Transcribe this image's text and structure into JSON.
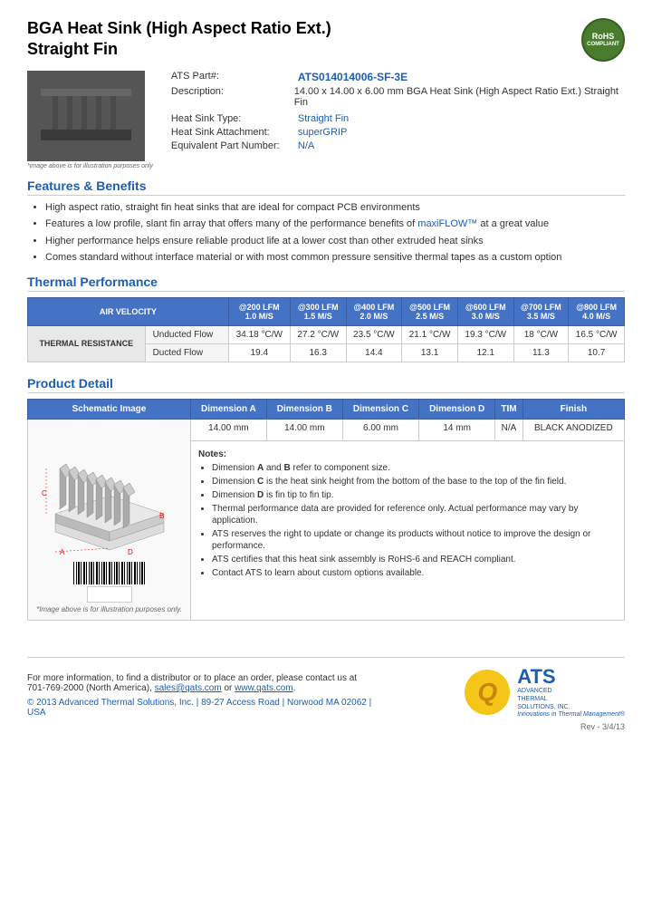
{
  "header": {
    "title_line1": "BGA Heat Sink (High Aspect Ratio Ext.)",
    "title_line2": "Straight Fin",
    "rohs": {
      "line1": "RoHS",
      "line2": "COMPLIANT"
    }
  },
  "product": {
    "part_number_label": "ATS Part#:",
    "part_number_value": "ATS014014006-SF-3E",
    "description_label": "Description:",
    "description_value": "14.00 x 14.00 x 6.00 mm  BGA Heat Sink (High Aspect Ratio Ext.) Straight Fin",
    "heat_sink_type_label": "Heat Sink Type:",
    "heat_sink_type_value": "Straight Fin",
    "attachment_label": "Heat Sink Attachment:",
    "attachment_value": "superGRIP",
    "equivalent_label": "Equivalent Part Number:",
    "equivalent_value": "N/A",
    "image_caption": "*image above is for illustration purposes only"
  },
  "features": {
    "section_title": "Features & Benefits",
    "items": [
      "High aspect ratio, straight fin heat sinks that are ideal for compact PCB environments",
      "Features a low profile, slant fin array that offers many of the performance benefits of maxiFLOW™ at a great value",
      "Higher performance helps ensure reliable product life at a lower cost than other extruded heat sinks",
      "Comes standard without interface material or with most common pressure sensitive thermal tapes as a custom option"
    ]
  },
  "thermal_performance": {
    "section_title": "Thermal Performance",
    "table": {
      "header_row1": {
        "col0": "AIR VELOCITY",
        "col1": "@200 LFM\n1.0 M/S",
        "col2": "@300 LFM\n1.5 M/S",
        "col3": "@400 LFM\n2.0 M/S",
        "col4": "@500 LFM\n2.5 M/S",
        "col5": "@600 LFM\n3.0 M/S",
        "col6": "@700 LFM\n3.5 M/S",
        "col7": "@800 LFM\n4.0 M/S"
      },
      "thermal_resistance_label": "THERMAL RESISTANCE",
      "row_unducted": {
        "label": "Unducted Flow",
        "values": [
          "34.18 °C/W",
          "27.2 °C/W",
          "23.5 °C/W",
          "21.1 °C/W",
          "19.3 °C/W",
          "18 °C/W",
          "16.5 °C/W"
        ]
      },
      "row_ducted": {
        "label": "Ducted Flow",
        "values": [
          "19.4",
          "16.3",
          "14.4",
          "13.1",
          "12.1",
          "11.3",
          "10.7"
        ]
      }
    }
  },
  "product_detail": {
    "section_title": "Product Detail",
    "table_headers": [
      "Schematic Image",
      "Dimension A",
      "Dimension B",
      "Dimension C",
      "Dimension D",
      "TIM",
      "Finish"
    ],
    "dimension_values": [
      "14.00 mm",
      "14.00 mm",
      "6.00 mm",
      "14 mm",
      "N/A",
      "BLACK ANODIZED"
    ],
    "notes_title": "Notes:",
    "notes": [
      "Dimension A and B refer to component size.",
      "Dimension C is the heat sink height from the bottom of the base to the top of the fin field.",
      "Dimension D is fin tip to fin tip.",
      "Thermal performance data are provided for reference only. Actual performance may vary by application.",
      "ATS reserves the right to update or change its products without notice to improve the design or performance.",
      "ATS certifies that this heat sink assembly is RoHS-6 and REACH compliant.",
      "Contact ATS to learn about custom options available."
    ],
    "schematic_caption": "*Image above is for illustration purposes only."
  },
  "footer": {
    "contact_text": "For more information, to find a distributor or to place an order, please contact us at\n701-769-2000 (North America),",
    "email": "sales@qats.com",
    "or_text": "or",
    "website": "www.qats.com",
    "copyright": "© 2013 Advanced Thermal Solutions, Inc. | 89-27 Access Road | Norwood MA  02062 | USA",
    "ats_q_letter": "Q",
    "ats_letters": "ATS",
    "ats_full_name": "ADVANCED\nTHERMAL\nSOLUTIONS, INC.",
    "ats_tagline": "Innovations in Thermal Management®",
    "rev_note": "Rev - 3/4/13"
  }
}
